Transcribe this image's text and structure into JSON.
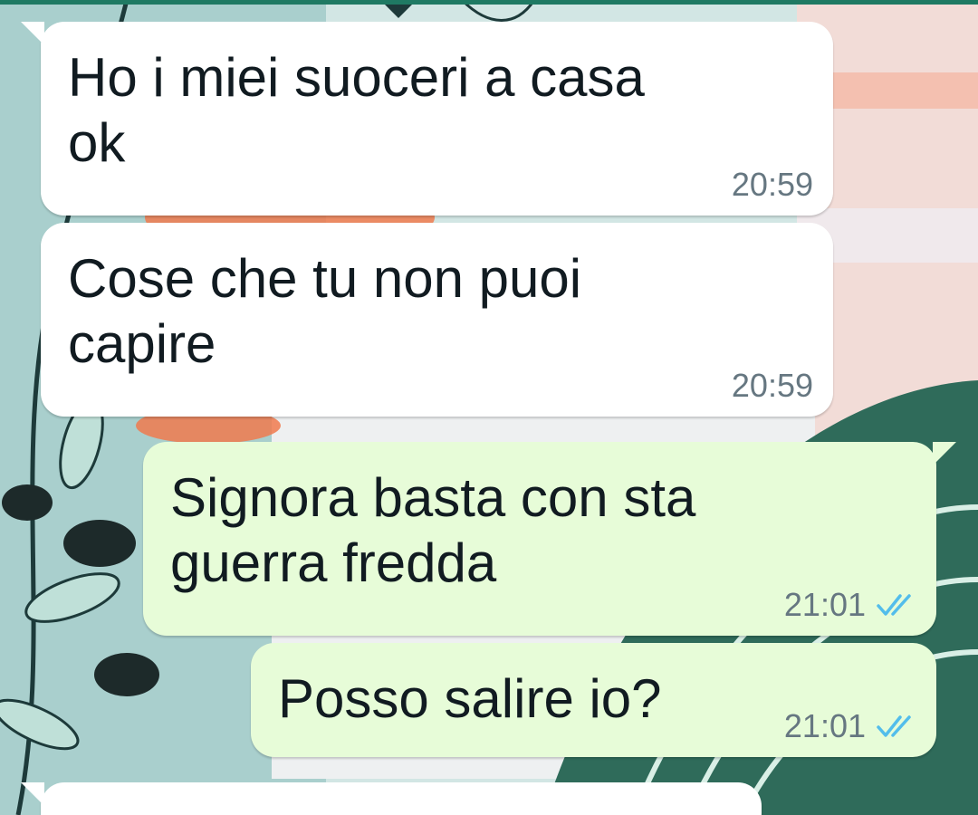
{
  "colors": {
    "incoming_bubble": "#ffffff",
    "outgoing_bubble": "#e7fcd8",
    "message_text": "#111b21",
    "timestamp": "#667781",
    "read_ticks": "#53bdeb",
    "header_strip": "#1f7a63"
  },
  "chat": {
    "messages": [
      {
        "direction": "incoming",
        "text": "Ho i miei suoceri a casa\nok",
        "time": "20:59"
      },
      {
        "direction": "incoming",
        "text": "Cose che tu non puoi\ncapire",
        "time": "20:59"
      },
      {
        "direction": "outgoing",
        "text": "Signora basta con sta\nguerra fredda",
        "time": "21:01",
        "status": "read"
      },
      {
        "direction": "outgoing",
        "text": "Posso salire io?",
        "time": "21:01",
        "status": "read"
      }
    ]
  },
  "icons": {
    "read_receipt": "double-check-icon"
  }
}
